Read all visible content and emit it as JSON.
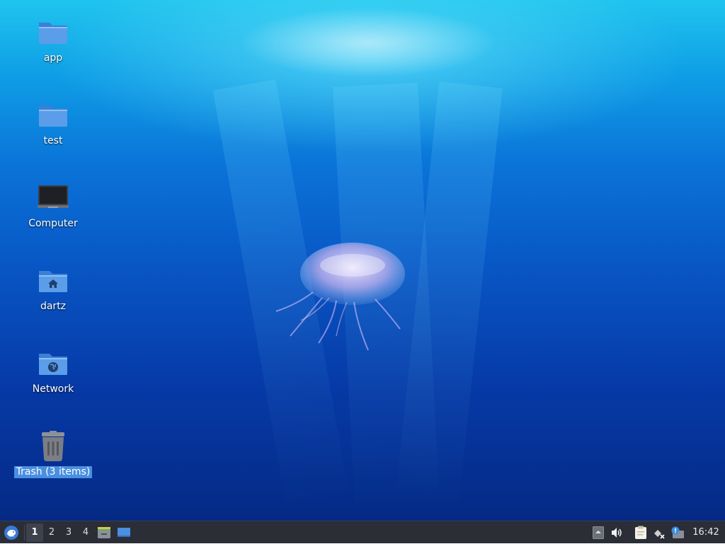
{
  "desktop": {
    "icons": [
      {
        "label": "app",
        "type": "folder-icon"
      },
      {
        "label": "test",
        "type": "folder-icon"
      },
      {
        "label": "Computer",
        "type": "computer-icon"
      },
      {
        "label": "dartz",
        "type": "home-folder-icon"
      },
      {
        "label": "Network",
        "type": "network-folder-icon"
      },
      {
        "label": "Trash (3 items)",
        "type": "trash-icon",
        "selected": true
      }
    ]
  },
  "panel": {
    "menu_icon": "xfce-mouse-icon",
    "workspaces": [
      "1",
      "2",
      "3",
      "4"
    ],
    "active_workspace": "1",
    "launchers": [
      "file-manager-icon",
      "show-desktop-icon"
    ],
    "tray": [
      "tray-arrow-icon",
      "volume-icon",
      "clipboard-icon",
      "network-icon",
      "notification-icon"
    ],
    "clock": "16:42"
  },
  "colors": {
    "panel_bg": "#2b2e36",
    "folder_blue": "#5b9de8",
    "selection": "#4a8fe0"
  }
}
